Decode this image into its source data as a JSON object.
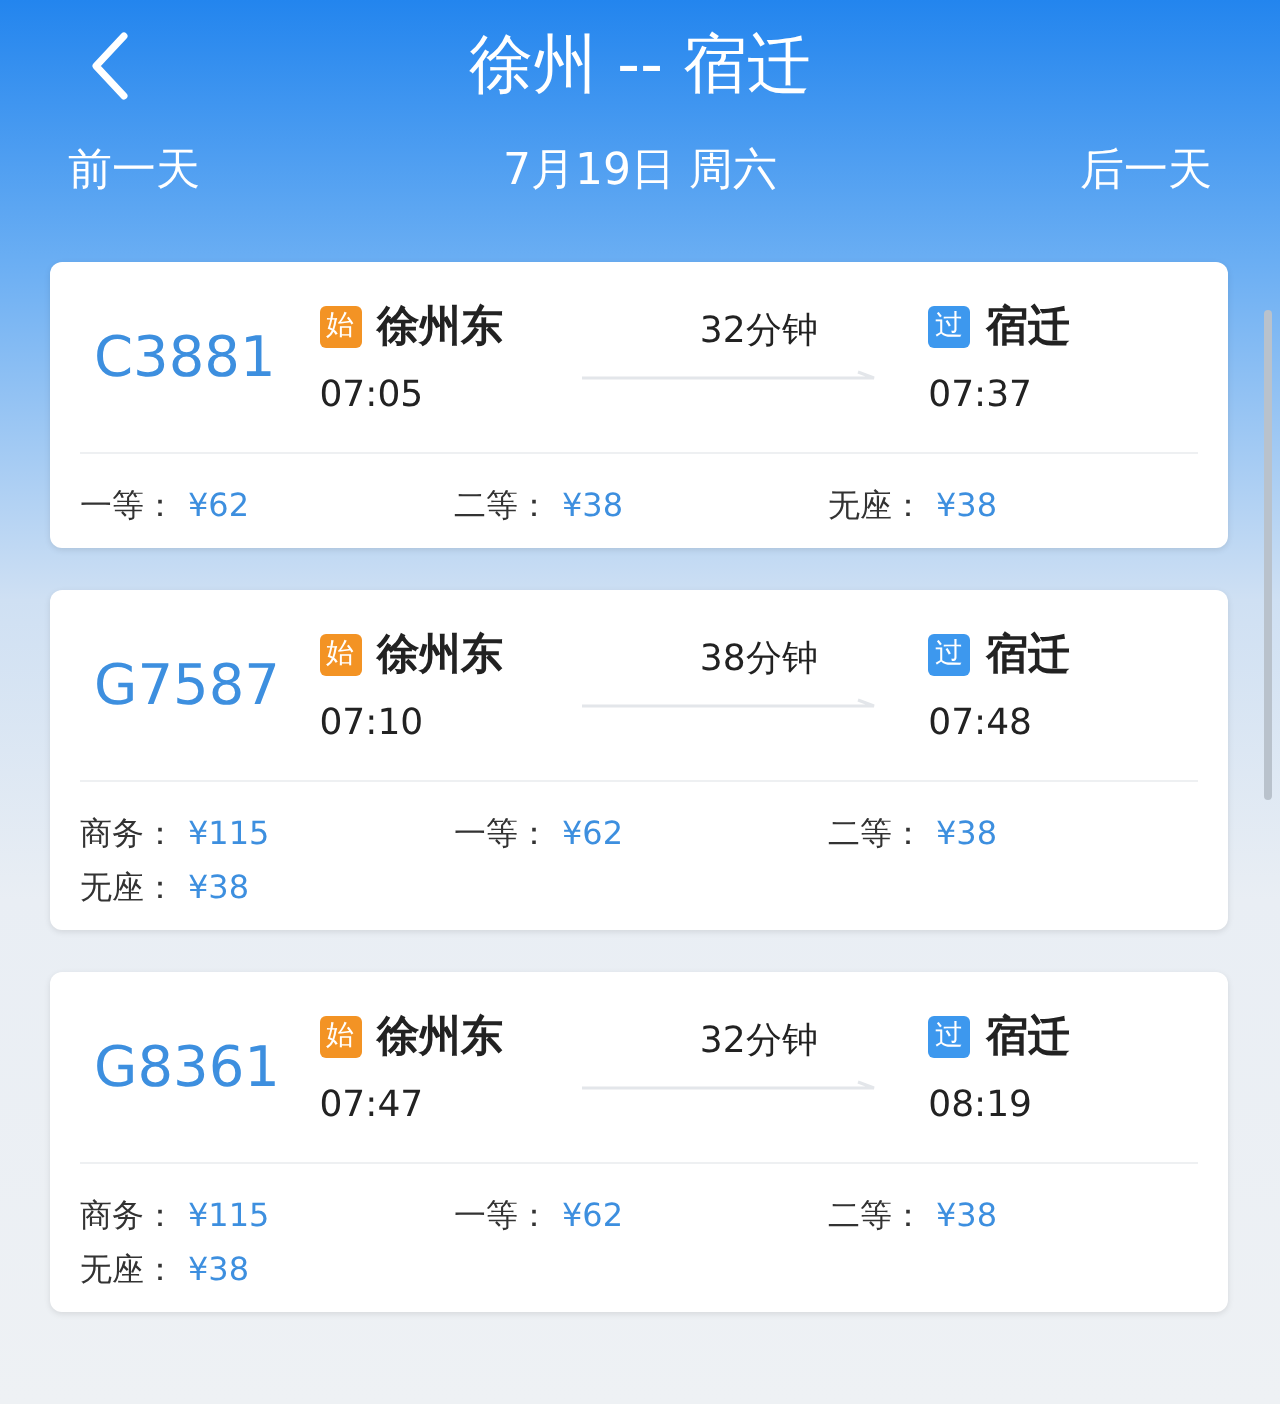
{
  "header": {
    "title": "徐州 -- 宿迁",
    "prev_day": "前一天",
    "date": "7月19日 周六",
    "next_day": "后一天"
  },
  "trains": [
    {
      "number": "C3881",
      "from": {
        "badge": "始",
        "kind": "start",
        "station": "徐州东",
        "time": "07:05"
      },
      "duration": "32分钟",
      "to": {
        "badge": "过",
        "kind": "pass",
        "station": "宿迁",
        "time": "07:37"
      },
      "prices": [
        {
          "label": "一等：",
          "price": "¥62"
        },
        {
          "label": "二等：",
          "price": "¥38"
        },
        {
          "label": "无座：",
          "price": "¥38"
        }
      ]
    },
    {
      "number": "G7587",
      "from": {
        "badge": "始",
        "kind": "start",
        "station": "徐州东",
        "time": "07:10"
      },
      "duration": "38分钟",
      "to": {
        "badge": "过",
        "kind": "pass",
        "station": "宿迁",
        "time": "07:48"
      },
      "prices": [
        {
          "label": "商务：",
          "price": "¥115"
        },
        {
          "label": "一等：",
          "price": "¥62"
        },
        {
          "label": "二等：",
          "price": "¥38"
        },
        {
          "label": "无座：",
          "price": "¥38"
        }
      ]
    },
    {
      "number": "G8361",
      "from": {
        "badge": "始",
        "kind": "start",
        "station": "徐州东",
        "time": "07:47"
      },
      "duration": "32分钟",
      "to": {
        "badge": "过",
        "kind": "pass",
        "station": "宿迁",
        "time": "08:19"
      },
      "prices": [
        {
          "label": "商务：",
          "price": "¥115"
        },
        {
          "label": "一等：",
          "price": "¥62"
        },
        {
          "label": "二等：",
          "price": "¥38"
        },
        {
          "label": "无座：",
          "price": "¥38"
        }
      ]
    }
  ]
}
